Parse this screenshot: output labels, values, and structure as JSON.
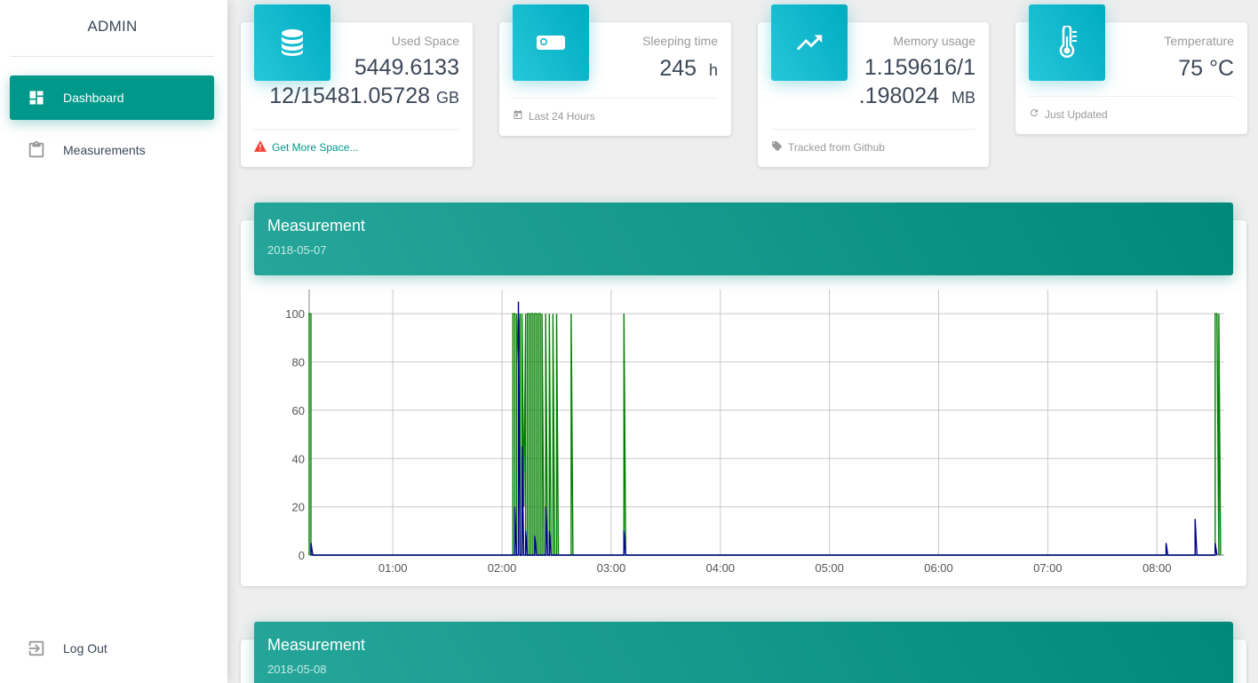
{
  "sidebar": {
    "brand": "ADMIN",
    "items": [
      {
        "label": "Dashboard",
        "icon": "dashboard-icon",
        "active": true
      },
      {
        "label": "Measurements",
        "icon": "clipboard-icon",
        "active": false
      }
    ],
    "logout_label": "Log Out"
  },
  "stats": [
    {
      "category": "Used Space",
      "value_line1": "5449.6133",
      "value_line2": "12/15481.05728",
      "unit": "GB",
      "icon": "storage-icon",
      "footer": "Get More Space...",
      "footer_icon": "warning-icon"
    },
    {
      "category": "Sleeping time",
      "value": "245",
      "unit": "h",
      "icon": "bed-icon",
      "footer": "Last 24 Hours",
      "footer_icon": "calendar-icon"
    },
    {
      "category": "Memory usage",
      "value_line1": "1.159616/1",
      "value_line2": ".198024",
      "unit": "MB",
      "icon": "trending-icon",
      "footer": "Tracked from Github",
      "footer_icon": "tag-icon"
    },
    {
      "category": "Temperature",
      "value": "75 °C",
      "icon": "thermometer-icon",
      "footer": "Just Updated",
      "footer_icon": "refresh-icon"
    }
  ],
  "panels": [
    {
      "title": "Measurement",
      "date": "2018-05-07"
    },
    {
      "title": "Measurement",
      "date": "2018-05-08"
    }
  ],
  "colors": {
    "accent": "#00988a",
    "stat_icon": "#00acc1",
    "series_green": "#008000",
    "series_blue": "#00008b",
    "warning": "#f44336"
  },
  "chart_data": {
    "type": "line",
    "ylim": [
      0,
      110
    ],
    "yticks": [
      0,
      20,
      40,
      60,
      80,
      100
    ],
    "xlim": [
      "00:14",
      "08:37"
    ],
    "xticks": [
      "01:00",
      "02:00",
      "03:00",
      "04:00",
      "05:00",
      "06:00",
      "07:00",
      "08:00"
    ],
    "grid": true,
    "series": [
      {
        "color": "green",
        "points": [
          [
            "00:14",
            0
          ],
          [
            "00:14",
            100
          ],
          [
            "00:15",
            100
          ],
          [
            "00:15",
            0
          ],
          [
            "02:06",
            0
          ],
          [
            "02:06",
            100
          ],
          [
            "02:07",
            100
          ],
          [
            "02:07",
            0
          ],
          [
            "02:08",
            0
          ],
          [
            "02:08",
            100
          ],
          [
            "02:09",
            80
          ],
          [
            "02:10",
            100
          ],
          [
            "02:10",
            0
          ],
          [
            "02:11",
            0
          ],
          [
            "02:11",
            100
          ],
          [
            "02:12",
            20
          ],
          [
            "02:13",
            100
          ],
          [
            "02:13",
            0
          ],
          [
            "02:14",
            0
          ],
          [
            "02:14",
            100
          ],
          [
            "02:15",
            100
          ],
          [
            "02:15",
            0
          ],
          [
            "02:16",
            0
          ],
          [
            "02:16",
            100
          ],
          [
            "02:17",
            100
          ],
          [
            "02:17",
            0
          ],
          [
            "02:18",
            0
          ],
          [
            "02:18",
            100
          ],
          [
            "02:19",
            100
          ],
          [
            "02:19",
            0
          ],
          [
            "02:20",
            0
          ],
          [
            "02:20",
            100
          ],
          [
            "02:21",
            100
          ],
          [
            "02:21",
            0
          ],
          [
            "02:22",
            0
          ],
          [
            "02:22",
            100
          ],
          [
            "02:23",
            0
          ],
          [
            "02:24",
            0
          ],
          [
            "02:24",
            100
          ],
          [
            "02:25",
            0
          ],
          [
            "02:26",
            0
          ],
          [
            "02:26",
            100
          ],
          [
            "02:27",
            0
          ],
          [
            "02:28",
            0
          ],
          [
            "02:28",
            100
          ],
          [
            "02:29",
            0
          ],
          [
            "02:30",
            0
          ],
          [
            "02:30",
            100
          ],
          [
            "02:31",
            0
          ],
          [
            "02:38",
            0
          ],
          [
            "02:38",
            100
          ],
          [
            "02:39",
            0
          ],
          [
            "03:07",
            0
          ],
          [
            "03:07",
            100
          ],
          [
            "03:08",
            0
          ],
          [
            "08:32",
            0
          ],
          [
            "08:32",
            100
          ],
          [
            "08:33",
            100
          ],
          [
            "08:34",
            0
          ],
          [
            "08:34",
            100
          ],
          [
            "08:35",
            0
          ]
        ]
      },
      {
        "color": "blue",
        "points": [
          [
            "00:15",
            0
          ],
          [
            "00:15",
            5
          ],
          [
            "00:16",
            0
          ],
          [
            "02:07",
            0
          ],
          [
            "02:07",
            20
          ],
          [
            "02:08",
            0
          ],
          [
            "02:09",
            0
          ],
          [
            "02:09",
            105
          ],
          [
            "02:10",
            0
          ],
          [
            "02:11",
            0
          ],
          [
            "02:11",
            45
          ],
          [
            "02:12",
            0
          ],
          [
            "02:13",
            0
          ],
          [
            "02:13",
            10
          ],
          [
            "02:14",
            0
          ],
          [
            "02:18",
            0
          ],
          [
            "02:18",
            8
          ],
          [
            "02:19",
            0
          ],
          [
            "02:24",
            0
          ],
          [
            "02:24",
            20
          ],
          [
            "02:25",
            0
          ],
          [
            "02:26",
            0
          ],
          [
            "02:26",
            10
          ],
          [
            "02:27",
            0
          ],
          [
            "03:07",
            0
          ],
          [
            "03:07",
            10
          ],
          [
            "03:08",
            0
          ],
          [
            "08:05",
            0
          ],
          [
            "08:05",
            5
          ],
          [
            "08:06",
            0
          ],
          [
            "08:21",
            0
          ],
          [
            "08:21",
            15
          ],
          [
            "08:22",
            0
          ],
          [
            "08:32",
            0
          ],
          [
            "08:32",
            5
          ],
          [
            "08:33",
            0
          ]
        ]
      }
    ]
  }
}
